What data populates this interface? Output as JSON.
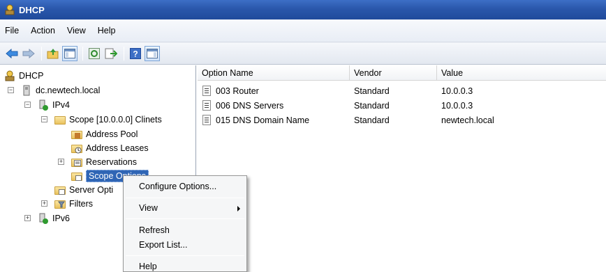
{
  "window": {
    "title": "DHCP"
  },
  "menu": {
    "file": "File",
    "action": "Action",
    "view": "View",
    "help": "Help"
  },
  "toolbar": {
    "buttons": [
      "back-arrow-icon",
      "forward-arrow-icon",
      "up-folder-icon",
      "show-hide-tree-icon",
      "refresh-icon",
      "export-list-icon",
      "help-icon",
      "show-hide-action-pane-icon"
    ]
  },
  "tree": {
    "root": "DHCP",
    "server": "dc.newtech.local",
    "ipv4": "IPv4",
    "scope": "Scope [10.0.0.0] Clinets",
    "address_pool": "Address Pool",
    "address_leases": "Address Leases",
    "reservations": "Reservations",
    "scope_options": "Scope Options",
    "server_options": "Server Opti",
    "filters": "Filters",
    "ipv6": "IPv6"
  },
  "list": {
    "columns": {
      "option_name": "Option Name",
      "vendor": "Vendor",
      "value": "Value"
    },
    "rows": [
      {
        "name": "003 Router",
        "vendor": "Standard",
        "value": "10.0.0.3"
      },
      {
        "name": "006 DNS Servers",
        "vendor": "Standard",
        "value": "10.0.0.3"
      },
      {
        "name": "015 DNS Domain Name",
        "vendor": "Standard",
        "value": "newtech.local"
      }
    ]
  },
  "context_menu": {
    "configure_options": "Configure Options...",
    "view": "View",
    "refresh": "Refresh",
    "export_list": "Export List...",
    "help": "Help"
  },
  "colors": {
    "title_bar": "#2a57ab",
    "selection": "#2f65b5",
    "menu_bg": "#f5f6f7"
  }
}
